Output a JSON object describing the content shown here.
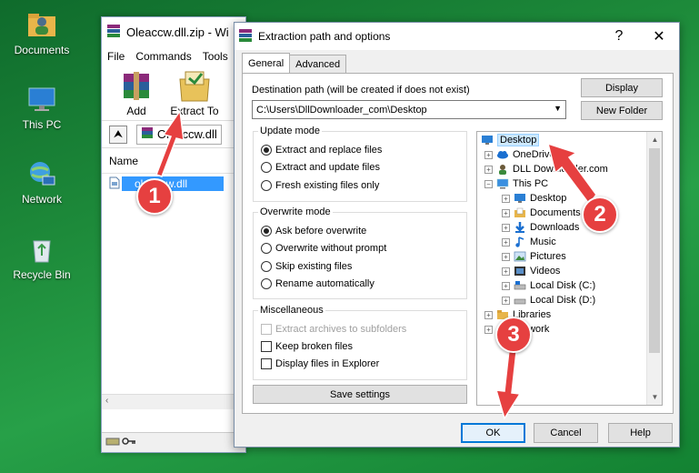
{
  "desktop": {
    "icons": [
      {
        "label": "Documents"
      },
      {
        "label": "This PC"
      },
      {
        "label": "Network"
      },
      {
        "label": "Recycle Bin"
      }
    ]
  },
  "winrar": {
    "title": "Oleaccw.dll.zip - Wi",
    "menu": [
      "File",
      "Commands",
      "Tools"
    ],
    "tools": [
      {
        "label": "Add"
      },
      {
        "label": "Extract To"
      }
    ],
    "path": "Oleaccw.dll",
    "column_name": "Name",
    "file": "oleaccw.dll"
  },
  "dialog": {
    "title": "Extraction path and options",
    "help": "?",
    "close": "✕",
    "tabs": [
      {
        "label": "General",
        "active": true
      },
      {
        "label": "Advanced",
        "active": false
      }
    ],
    "destination_label": "Destination path (will be created if does not exist)",
    "destination_value": "C:\\Users\\DllDownloader_com\\Desktop",
    "display_button": "Display",
    "new_folder_button": "New Folder",
    "update_mode": {
      "title": "Update mode",
      "options": [
        {
          "label": "Extract and replace files",
          "selected": true
        },
        {
          "label": "Extract and update files",
          "selected": false
        },
        {
          "label": "Fresh existing files only",
          "selected": false
        }
      ]
    },
    "overwrite_mode": {
      "title": "Overwrite mode",
      "options": [
        {
          "label": "Ask before overwrite",
          "selected": true
        },
        {
          "label": "Overwrite without prompt",
          "selected": false
        },
        {
          "label": "Skip existing files",
          "selected": false
        },
        {
          "label": "Rename automatically",
          "selected": false
        }
      ]
    },
    "misc": {
      "title": "Miscellaneous",
      "options": [
        {
          "label": "Extract archives to subfolders",
          "checked": false,
          "disabled": true
        },
        {
          "label": "Keep broken files",
          "checked": false,
          "disabled": false
        },
        {
          "label": "Display files in Explorer",
          "checked": false,
          "disabled": false
        }
      ]
    },
    "save_settings": "Save settings",
    "tree": [
      {
        "label": "Desktop",
        "level": 0,
        "selected": true,
        "expander": "",
        "icon": "desktop-icon"
      },
      {
        "label": "OneDrive",
        "level": 1,
        "selected": false,
        "expander": "+",
        "icon": "cloud-icon"
      },
      {
        "label": "DLL Downloader.com",
        "level": 1,
        "selected": false,
        "expander": "+",
        "icon": "user-icon"
      },
      {
        "label": "This PC",
        "level": 1,
        "selected": false,
        "expander": "−",
        "icon": "pc-icon"
      },
      {
        "label": "Desktop",
        "level": 2,
        "selected": false,
        "expander": "+",
        "icon": "desktop-icon"
      },
      {
        "label": "Documents",
        "level": 2,
        "selected": false,
        "expander": "+",
        "icon": "documents-icon"
      },
      {
        "label": "Downloads",
        "level": 2,
        "selected": false,
        "expander": "+",
        "icon": "downloads-icon"
      },
      {
        "label": "Music",
        "level": 2,
        "selected": false,
        "expander": "+",
        "icon": "music-icon"
      },
      {
        "label": "Pictures",
        "level": 2,
        "selected": false,
        "expander": "+",
        "icon": "pictures-icon"
      },
      {
        "label": "Videos",
        "level": 2,
        "selected": false,
        "expander": "+",
        "icon": "videos-icon"
      },
      {
        "label": "Local Disk (C:)",
        "level": 2,
        "selected": false,
        "expander": "+",
        "icon": "disk-icon"
      },
      {
        "label": "Local Disk (D:)",
        "level": 2,
        "selected": false,
        "expander": "+",
        "icon": "disk-icon"
      },
      {
        "label": "Libraries",
        "level": 1,
        "selected": false,
        "expander": "+",
        "icon": "folder-icon"
      },
      {
        "label": "Network",
        "level": 1,
        "selected": false,
        "expander": "+",
        "icon": "network-icon"
      }
    ],
    "ok": "OK",
    "cancel": "Cancel",
    "help_button": "Help"
  },
  "annotations": [
    {
      "number": "1"
    },
    {
      "number": "2"
    },
    {
      "number": "3"
    }
  ],
  "colors": {
    "accent": "#0078d7",
    "selection": "#3399ff",
    "badge": "#e64040"
  }
}
